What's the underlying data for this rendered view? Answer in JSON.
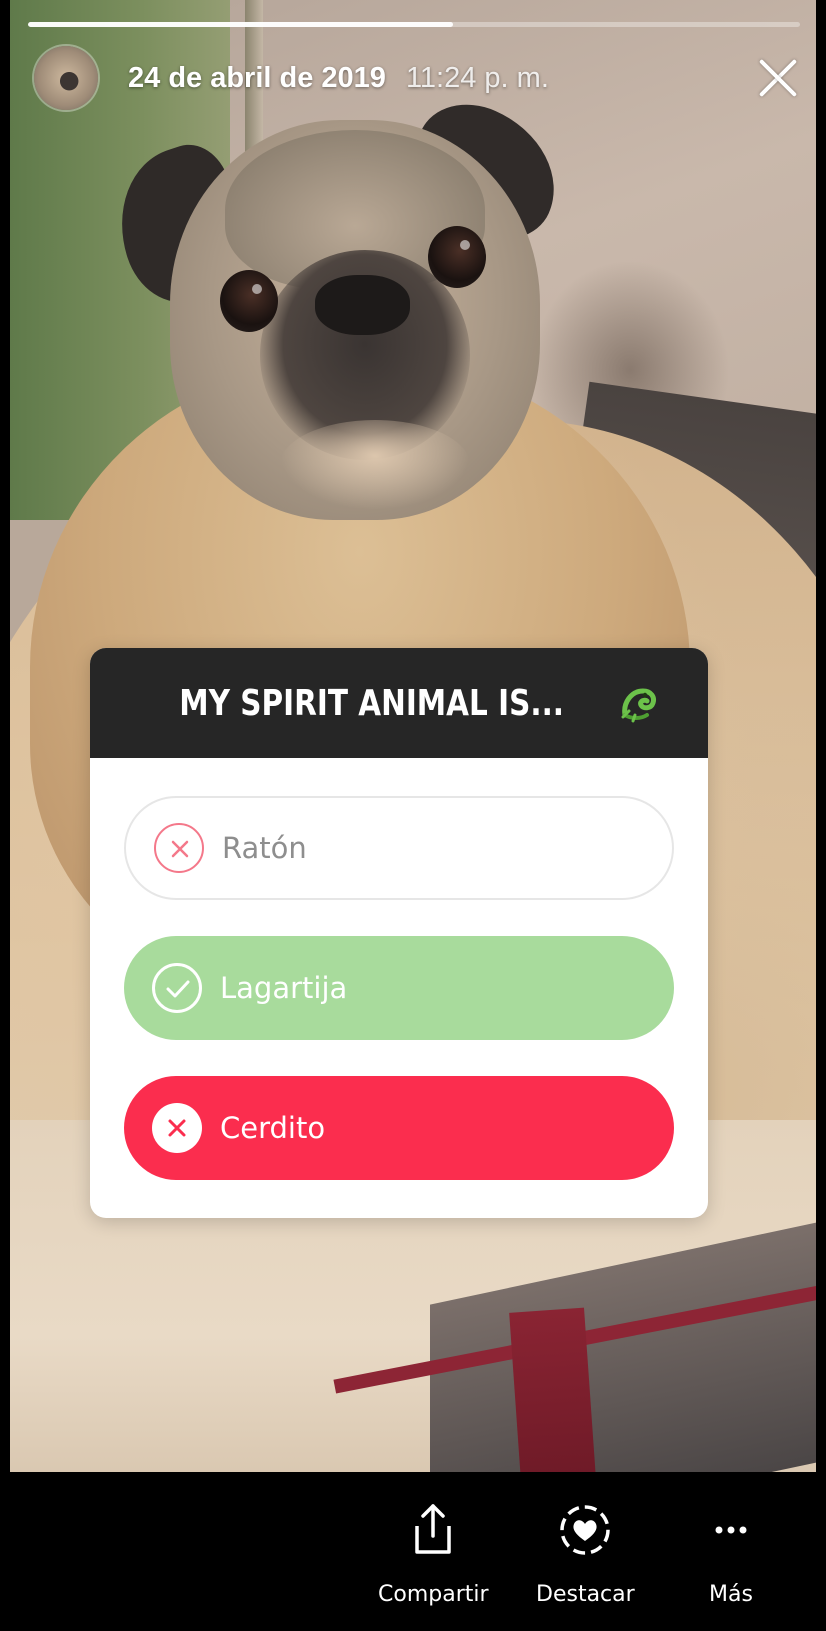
{
  "story": {
    "date": "24 de abril de 2019",
    "time": "11:24 p. m.",
    "progress": 0.55,
    "close_icon": "close-icon",
    "avatar_icon": "avatar"
  },
  "quiz": {
    "question": "MY SPIRIT ANIMAL IS...",
    "emoji": "lizard-emoji",
    "options": [
      {
        "label": "Ratón",
        "state": "neutral",
        "icon": "x-circle-icon"
      },
      {
        "label": "Lagartija",
        "state": "correct",
        "icon": "check-circle-icon"
      },
      {
        "label": "Cerdito",
        "state": "selected-wrong",
        "icon": "x-circle-icon"
      }
    ],
    "colors": {
      "correct": "#a8db9c",
      "wrong": "#fb2d4e",
      "header": "#262626"
    }
  },
  "actions": {
    "share_label": "Compartir",
    "share_icon": "share-icon",
    "highlight_label": "Destacar",
    "highlight_icon": "highlight-heart-icon",
    "more_label": "Más",
    "more_icon": "more-dots-icon"
  }
}
